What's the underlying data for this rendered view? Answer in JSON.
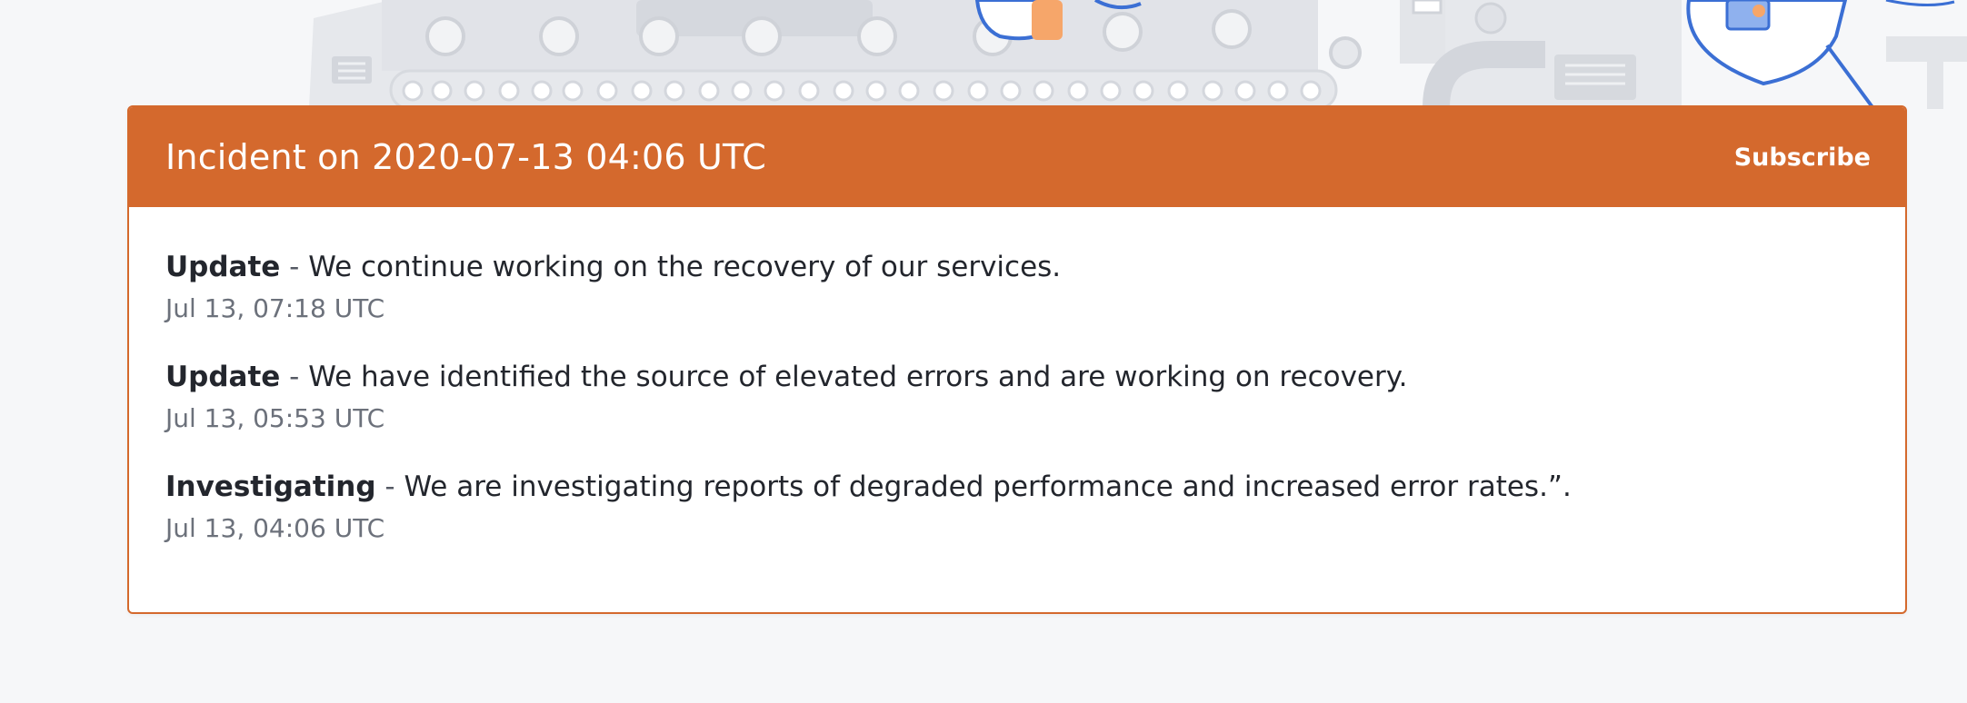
{
  "incident": {
    "title": "Incident on 2020-07-13 04:06 UTC",
    "subscribe_label": "Subscribe",
    "header_color": "#d4692d",
    "updates": [
      {
        "status": "Update",
        "separator": " - ",
        "message": "We continue working on the recovery of our services.",
        "time": "Jul 13, 07:18 UTC"
      },
      {
        "status": "Update",
        "separator": " - ",
        "message": "We have identified the source of elevated errors and are working on recovery.",
        "time": "Jul 13, 05:53 UTC"
      },
      {
        "status": "Investigating",
        "separator": " - ",
        "message": "We are investigating reports of degraded performance and increased error rates.”.",
        "time": "Jul 13, 04:06 UTC"
      }
    ]
  }
}
